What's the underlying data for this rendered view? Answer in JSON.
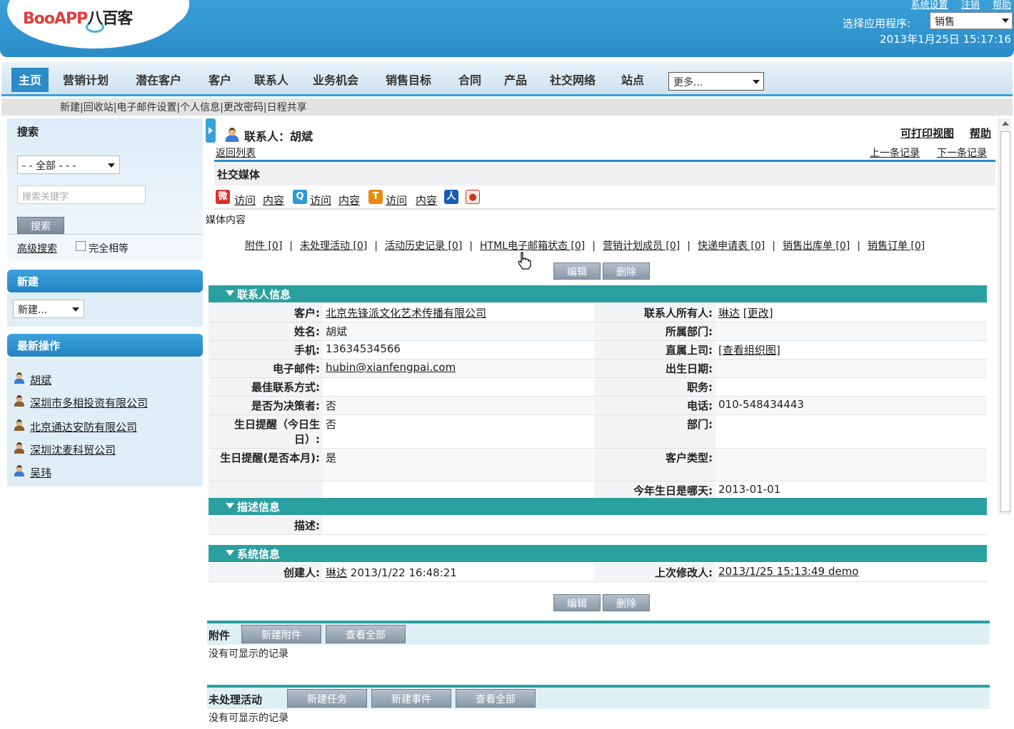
{
  "header": {
    "logo_latin": "BooAPP",
    "logo_cn": "八百客",
    "links": [
      "系统设置",
      "注销",
      "帮助"
    ],
    "app_label": "选择应用程序:",
    "app_selected": "销售",
    "datetime": "2013年1月25日  15:17:16"
  },
  "nav": {
    "tabs": [
      "主页",
      "营销计划",
      "潜在客户",
      "客户",
      "联系人",
      "业务机会",
      "销售目标",
      "合同",
      "产品",
      "社交网络",
      "站点"
    ],
    "more": "更多..."
  },
  "subbar": "新建|回收站|电子邮件设置|个人信息|更改密码|日程共享",
  "sidebar": {
    "search_title": "搜索",
    "scope": "- - 全部 - - -",
    "keyword_placeholder": "搜索关键字",
    "search_button": "搜索",
    "advanced": "高级搜索",
    "exact_label": "完全相等",
    "new_title": "新建",
    "new_select": "新建...",
    "recent_title": "最新操作",
    "recent": [
      "胡斌",
      "深圳市多相投资有限公司",
      "北京通达安防有限公司",
      "深圳沈麦科贸公司",
      "吴玮"
    ]
  },
  "record": {
    "title": "联系人：胡斌",
    "print_view": "可打印视图",
    "help": "帮助",
    "back": "返回列表",
    "prev": "上一条记录",
    "next": "下一条记录",
    "social_header": "社交媒体",
    "visit": "访问",
    "content": "内容",
    "media_content": "媒体内容"
  },
  "related_links": [
    "附件 [0]",
    "未处理活动 [0]",
    "活动历史记录 [0]",
    "HTML电子邮箱状态 [0]",
    "营销计划成员 [0]",
    "快递申请表 [0]",
    "销售出库单 [0]",
    "销售订单 [0]"
  ],
  "buttons": {
    "edit": "编辑",
    "delete": "删除"
  },
  "sections": {
    "contact_info": "联系人信息",
    "description_info": "描述信息",
    "system_info": "系统信息"
  },
  "contact": {
    "customer_label": "客户:",
    "customer": "北京先锋派文化艺术传播有限公司",
    "owner_label": "联系人所有人:",
    "owner": "琳达",
    "owner_change": "[更改]",
    "name_label": "姓名:",
    "name": "胡斌",
    "dept_label": "所属部门:",
    "mobile_label": "手机:",
    "mobile": "13634534566",
    "manager_label": "直属上司:",
    "manager_link": "[查看组织图]",
    "email_label": "电子邮件:",
    "email": "hubin@xianfengpai.com",
    "birthday_label": "出生日期:",
    "best_contact_label": "最佳联系方式:",
    "position_label": "职务:",
    "decision_label": "是否为决策者:",
    "decision": "否",
    "phone_label": "电话:",
    "phone": "010-548434443",
    "bday_today_label": "生日提醒（今日生日）:",
    "bday_today": "否",
    "department_label": "部门:",
    "bday_month_label": "生日提醒(是否本月):",
    "bday_month": "是",
    "customer_type_label": "客户类型:",
    "bday_this_year_label": "今年生日是哪天:",
    "bday_this_year": "2013-01-01"
  },
  "description": {
    "label": "描述:"
  },
  "system": {
    "creator_label": "创建人:",
    "creator": "琳达",
    "created": "2013/1/22 16:48:21",
    "modifier_label": "上次修改人:",
    "modified": "2013/1/25 15:13:49 demo"
  },
  "attachments": {
    "title": "附件",
    "new": "新建附件",
    "view_all": "查看全部",
    "empty": "没有可显示的记录"
  },
  "open_activities": {
    "title": "未处理活动",
    "new_task": "新建任务",
    "new_event": "新建事件",
    "view_all": "查看全部",
    "empty": "没有可显示的记录"
  }
}
